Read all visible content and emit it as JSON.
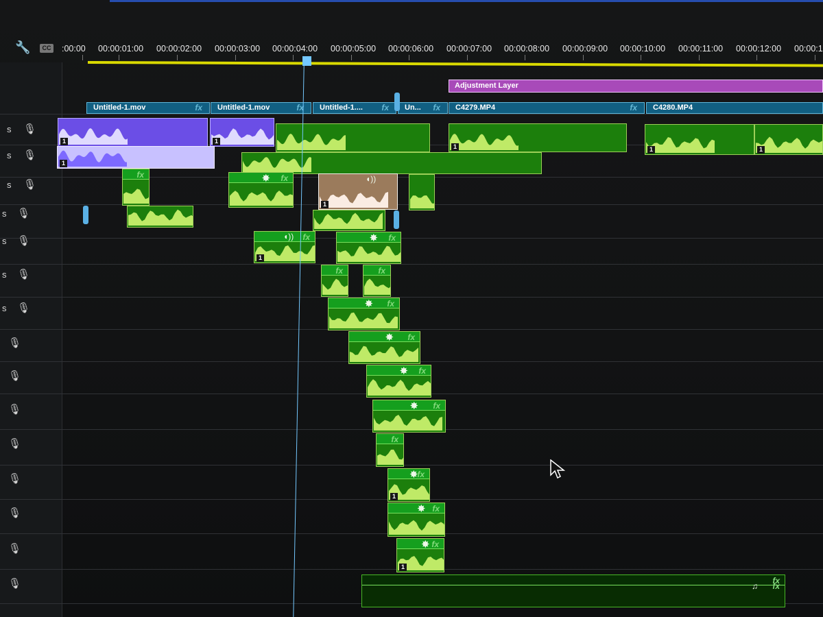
{
  "timeline": {
    "time_labels": [
      ":00:00",
      "00:00:01:00",
      "00:00:02:00",
      "00:00:03:00",
      "00:00:04:00",
      "00:00:05:00",
      "00:00:06:00",
      "00:00:07:00",
      "00:00:08:00",
      "00:00:09:00",
      "00:00:10:00",
      "00:00:11:00",
      "00:00:12:00",
      "00:00:1"
    ],
    "cc": "CC",
    "adjustment_layer": "Adjustment Layer",
    "video_clips": [
      "Untitled-1.mov",
      "Untitled-1.mov",
      "Untitled-1....",
      "Un...",
      "C4279.MP4",
      "C4280.MP4"
    ],
    "solo_label": "s",
    "clip_badge": "1",
    "fx": "fx",
    "star": "✸",
    "music": "♫"
  },
  "icons": [
    "wrench-icon",
    "microphone-icon",
    "audio-waveform-icon",
    "star-effect-icon",
    "music-note-icon",
    "cursor-icon"
  ],
  "colors": {
    "background": "#121314",
    "audio_green": "#1c7f0c",
    "audio_light": "#c8f06d",
    "purple_audio": "#6b4ee6",
    "video_blue": "#115f82",
    "adjustment_purple": "#a84ab9",
    "playhead_blue": "#74c8ff",
    "work_area": "#d9d900"
  }
}
